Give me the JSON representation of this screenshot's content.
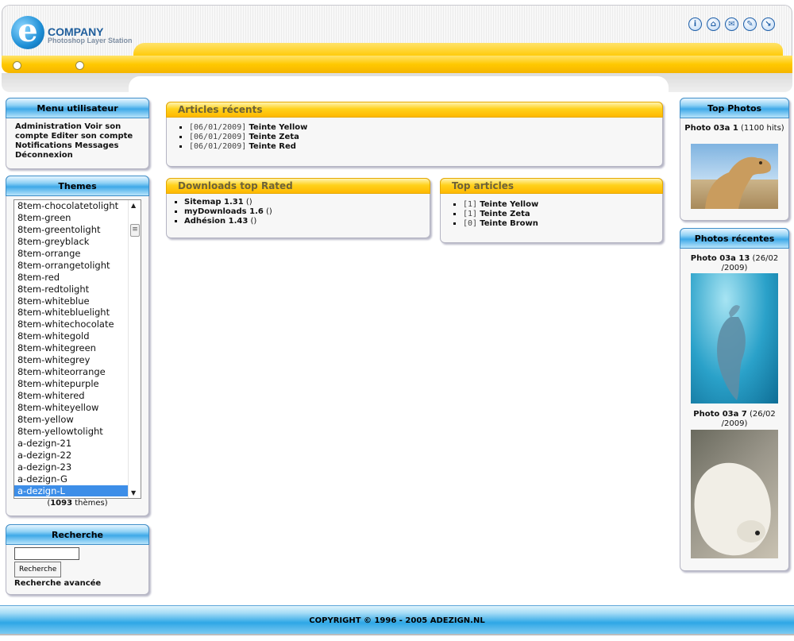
{
  "header": {
    "logo_letter": "e",
    "brand_name": "COMPANY",
    "brand_sub": "Photoshop Layer Station",
    "icons": [
      "info-icon",
      "home-icon",
      "mail-icon",
      "edit-icon",
      "exit-icon"
    ]
  },
  "user_menu": {
    "title": "Menu utilisateur",
    "links": [
      "Administration",
      "Voir son compte",
      "Editer son compte",
      "Notifications",
      "Messages",
      "Déconnexion"
    ]
  },
  "themes": {
    "title": "Themes",
    "options": [
      "8tem-chocolatetolight",
      "8tem-green",
      "8tem-greentolight",
      "8tem-greyblack",
      "8tem-orrange",
      "8tem-orrangetolight",
      "8tem-red",
      "8tem-redtolight",
      "8tem-whiteblue",
      "8tem-whitebluelight",
      "8tem-whitechocolate",
      "8tem-whitegold",
      "8tem-whitegreen",
      "8tem-whitegrey",
      "8tem-whiteorrange",
      "8tem-whitepurple",
      "8tem-whitered",
      "8tem-whiteyellow",
      "8tem-yellow",
      "8tem-yellowtolight",
      "a-dezign-21",
      "a-dezign-22",
      "a-dezign-23",
      "a-dezign-G",
      "a-dezign-L"
    ],
    "selected": "a-dezign-L",
    "count_open": "(",
    "count": "1093",
    "count_suffix": " thèmes)"
  },
  "search": {
    "title": "Recherche",
    "input_value": "",
    "button_label": "Recherche",
    "advanced_link": "Recherche avancée"
  },
  "recent_articles": {
    "title": "Articles récents",
    "items": [
      {
        "date": "[06/01/2009]",
        "title": "Teinte Yellow"
      },
      {
        "date": "[06/01/2009]",
        "title": "Teinte Zeta"
      },
      {
        "date": "[06/01/2009]",
        "title": "Teinte Red"
      }
    ]
  },
  "downloads": {
    "title": "Downloads top Rated",
    "items": [
      {
        "name": "Sitemap 1.31",
        "extra": " ()"
      },
      {
        "name": "myDownloads 1.6",
        "extra": " ()"
      },
      {
        "name": "Adhésion 1.43",
        "extra": " ()"
      }
    ]
  },
  "top_articles": {
    "title": "Top articles",
    "items": [
      {
        "count": "[1]",
        "title": "Teinte Yellow"
      },
      {
        "count": "[1]",
        "title": "Teinte Zeta"
      },
      {
        "count": "[0]",
        "title": "Teinte Brown"
      }
    ]
  },
  "top_photos": {
    "title": "Top Photos",
    "items": [
      {
        "name": "Photo 03a 1",
        "meta": " (1100 hits)"
      }
    ]
  },
  "recent_photos": {
    "title": "Photos récentes",
    "items": [
      {
        "name": "Photo 03a 13",
        "meta": " (26/02 /2009)"
      },
      {
        "name": "Photo 03a 7",
        "meta": " (26/02 /2009)"
      }
    ]
  },
  "footer": {
    "copyright": "COPYRIGHT © 1996 - 2005 ADEZIGN.NL"
  },
  "colors": {
    "accent_blue": "#3fa9e8",
    "accent_yellow": "#ffc800",
    "selection": "#3d8ee8"
  }
}
